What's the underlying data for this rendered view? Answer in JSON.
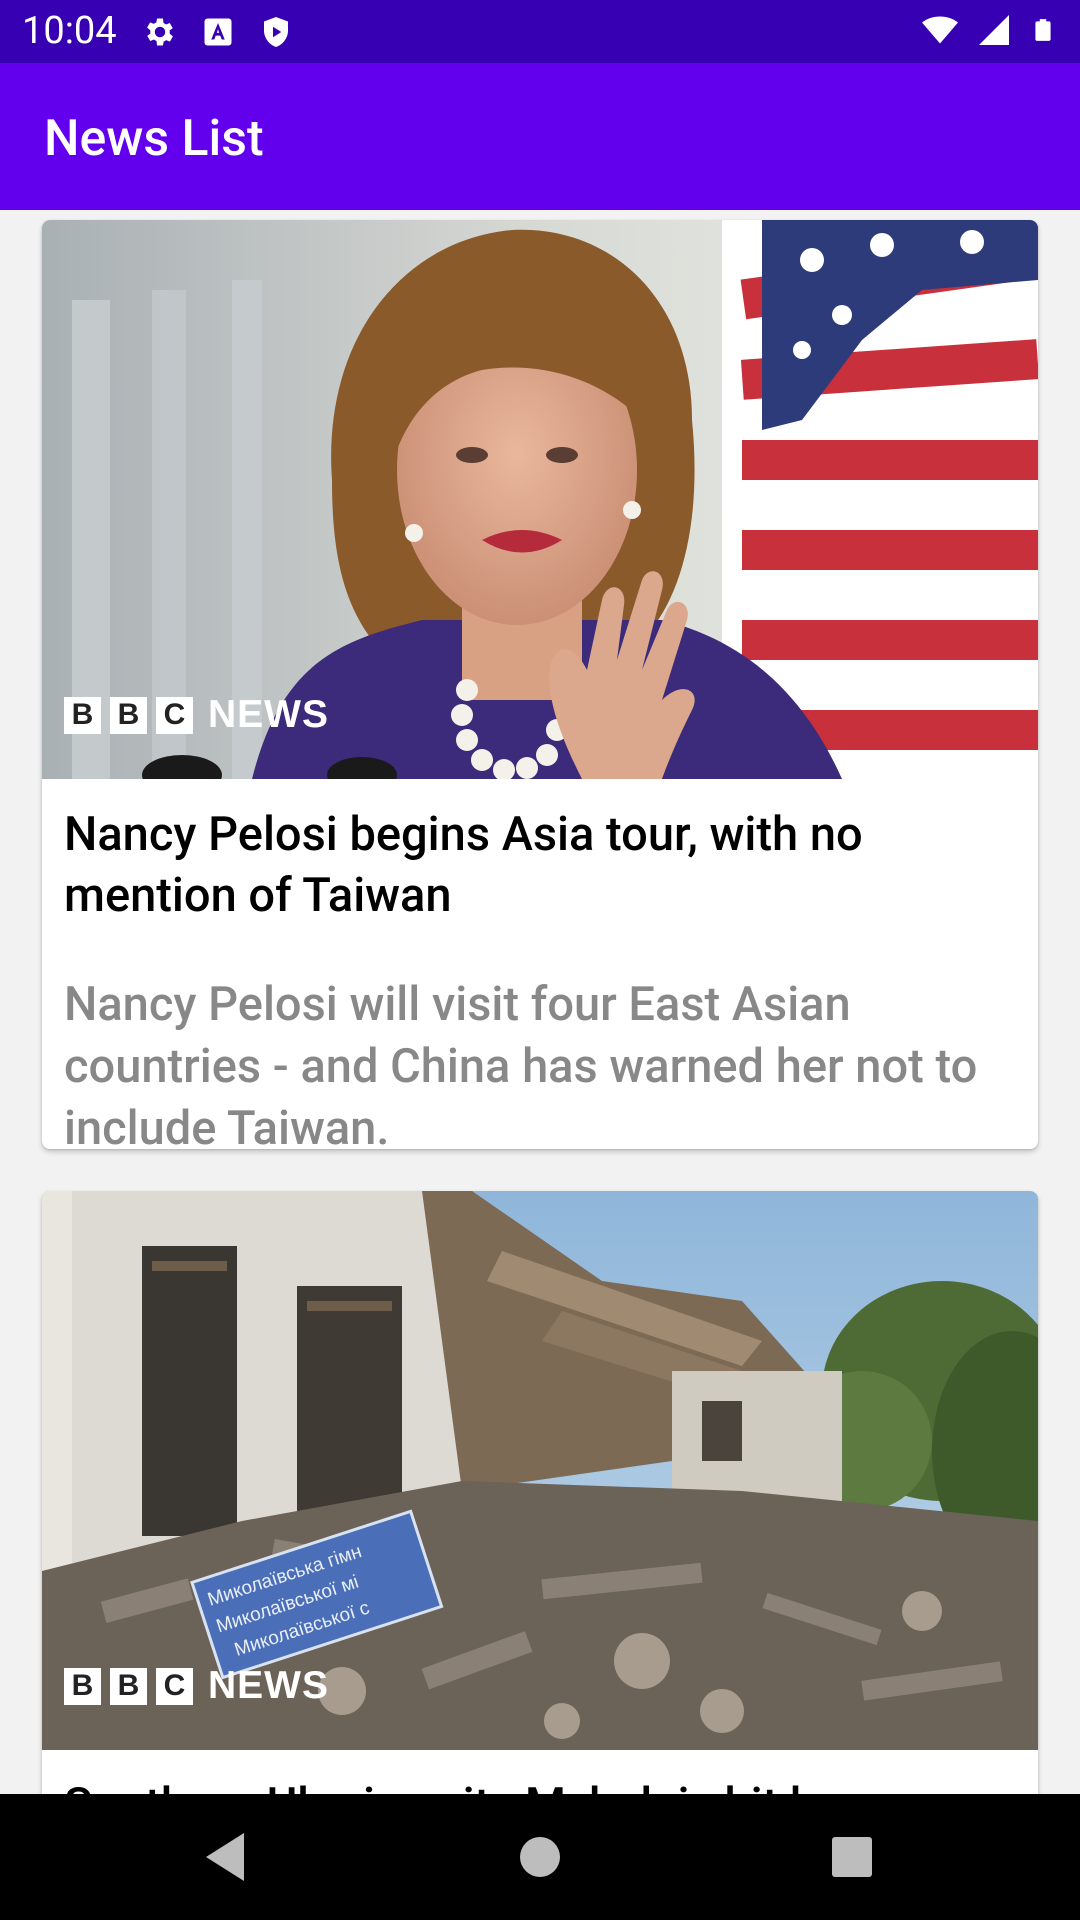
{
  "status_bar": {
    "time": "10:04",
    "left_icons": [
      "settings-icon",
      "a-font-icon",
      "play-protect-icon"
    ],
    "right_icons": [
      "wifi-icon",
      "signal-icon",
      "battery-icon"
    ]
  },
  "app_bar": {
    "title": "News List"
  },
  "articles": [
    {
      "title": "Nancy Pelosi begins Asia tour, with no mention of Taiwan",
      "description": "Nancy Pelosi will visit four East Asian countries - and China has warned her not to include Taiwan.",
      "logo": {
        "letters": [
          "B",
          "B",
          "C"
        ],
        "word": "NEWS"
      }
    },
    {
      "title": "Southern Ukraine city Mykolaiv hit by heaviest shelling",
      "sign_lines": [
        "Миколаївська гімн",
        "Миколаївської мі",
        "Миколаївської с"
      ],
      "logo": {
        "letters": [
          "B",
          "B",
          "C"
        ],
        "word": "NEWS"
      }
    }
  ],
  "nav_bar": {
    "buttons": [
      "back-icon",
      "home-icon",
      "recents-icon"
    ]
  },
  "colors": {
    "status_bar": "#3700B3",
    "app_bar": "#6200EE",
    "description": "#888888"
  }
}
